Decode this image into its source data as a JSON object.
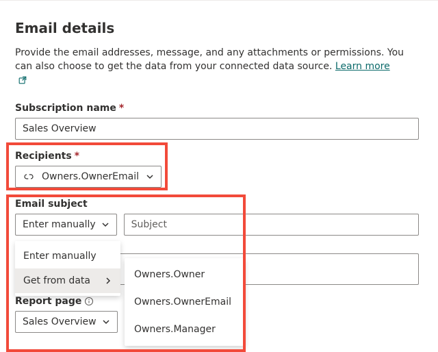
{
  "header": {
    "title": "Email details",
    "description_a": "Provide the email addresses, message, and any attachments or permissions. You can also choose to get the data from your connected data source. ",
    "learn_more": "Learn more"
  },
  "subscription": {
    "label": "Subscription name",
    "value": "Sales Overview"
  },
  "recipients": {
    "label": "Recipients",
    "chip_value": "Owners.OwnerEmail"
  },
  "email_subject": {
    "label": "Email subject",
    "mode_label": "Enter manually",
    "subject_placeholder": "Subject",
    "menu": {
      "enter_manually": "Enter manually",
      "get_from_data": "Get from data",
      "submenu": [
        "Owners.Owner",
        "Owners.OwnerEmail",
        "Owners.Manager"
      ]
    }
  },
  "report_page": {
    "label": "Report page",
    "value": "Sales Overview"
  }
}
